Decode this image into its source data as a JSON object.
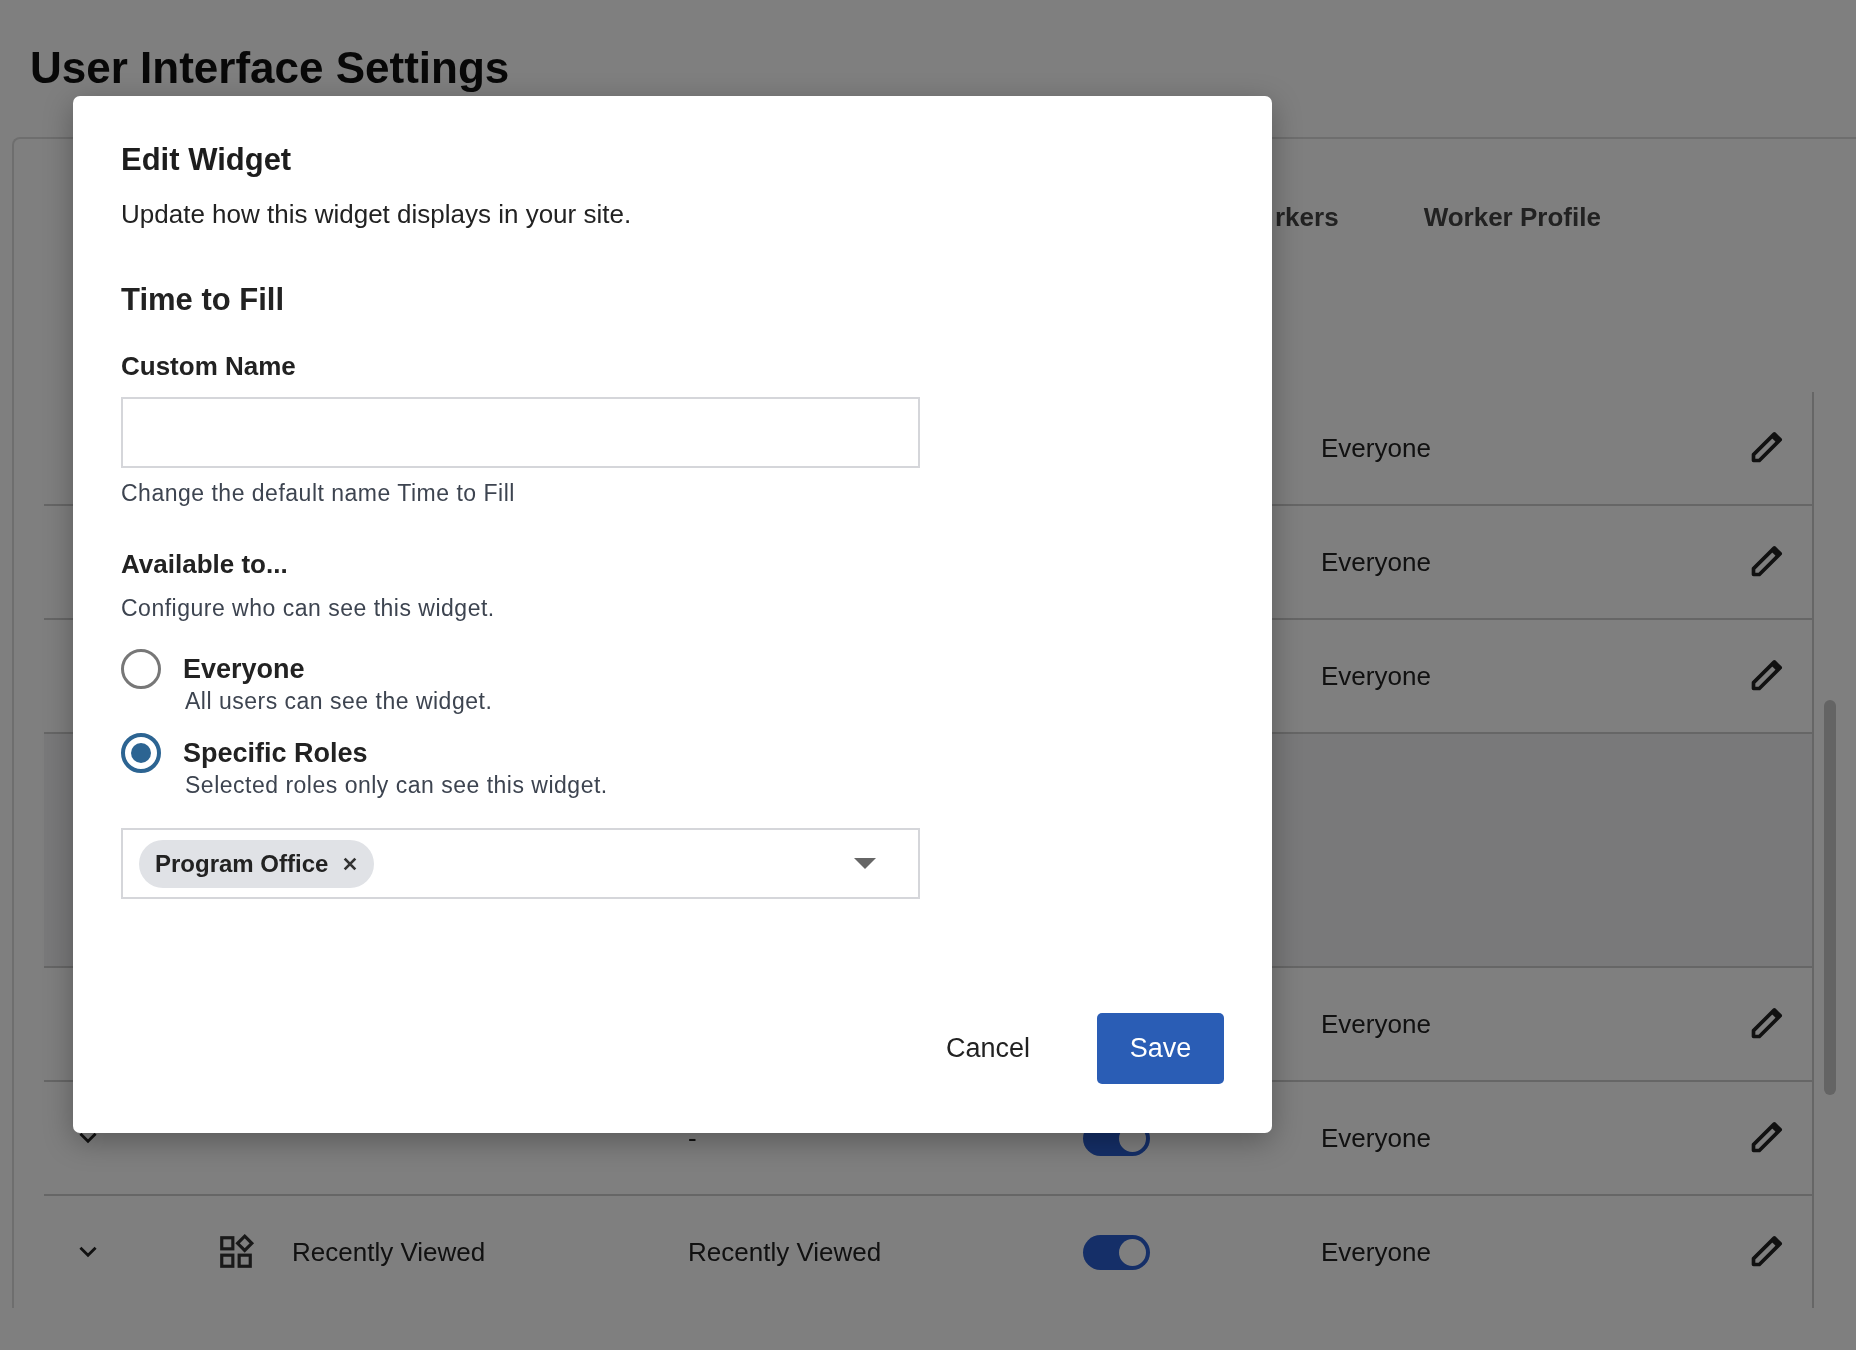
{
  "page_title": "User Interface Settings",
  "tabs": [
    {
      "label": "rkers",
      "selected": false
    },
    {
      "label": "Worker Profile",
      "selected": false
    }
  ],
  "table": {
    "rows": [
      {
        "kind": "widget",
        "availability": "Everyone"
      },
      {
        "kind": "widget",
        "availability": "Everyone"
      },
      {
        "kind": "widget",
        "availability": "Everyone"
      },
      {
        "kind": "detail"
      },
      {
        "kind": "widget",
        "availability": "Everyone"
      },
      {
        "kind": "widget",
        "expanded": false,
        "custom_name": "-",
        "on": true,
        "availability": "Everyone"
      },
      {
        "kind": "widget",
        "expanded": false,
        "name": "Recently Viewed",
        "custom_name": "Recently Viewed",
        "on": true,
        "availability": "Everyone"
      }
    ]
  },
  "dialog": {
    "title": "Edit Widget",
    "subtitle": "Update how this widget displays in your site.",
    "widget_name": "Time to Fill",
    "custom_name": {
      "label": "Custom Name",
      "help": "Change the default name Time to Fill"
    },
    "availability": {
      "label": "Available to...",
      "hint": "Configure who can see this widget.",
      "options": [
        {
          "label": "Everyone",
          "description": "All users can see the widget.",
          "selected": false
        },
        {
          "label": "Specific Roles",
          "description": "Selected roles only can see this widget.",
          "selected": true
        }
      ],
      "roles": [
        "Program Office"
      ]
    },
    "buttons": [
      {
        "label": "Cancel",
        "kind": "text"
      },
      {
        "label": "Save",
        "kind": "primary"
      }
    ]
  }
}
